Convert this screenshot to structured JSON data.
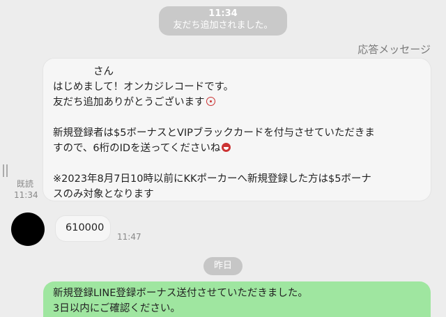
{
  "system_notice": {
    "time": "11:34",
    "text": "友だち追加されました。"
  },
  "auto_reply_label": "応答メッセージ",
  "main_message": {
    "greeting": "さん",
    "lines": [
      "はじめまして！オンカジレコードです。",
      "友だち追加ありがとうございます",
      "新規登録者は$5ボーナスとVIPブラックカードを付与させていただきま",
      "すので、6桁のIDを送ってくださいね",
      "※2023年8月7日10時以前にKKポーカーへ新規登録した方は$5ボーナ",
      "スのみ対象となります"
    ],
    "emojis": [
      "surprise-emoji",
      "laugh-emoji"
    ],
    "read_label": "既読",
    "read_time": "11:34"
  },
  "user_message": {
    "text": "610000",
    "time": "11:47"
  },
  "date_separator": "昨日",
  "green_message": {
    "lines": [
      "新規登録LINE登録ボーナス送付させていただきました。",
      "3日以内にご確認ください。"
    ]
  },
  "colors": {
    "background": "#ededed",
    "bubble_gray": "#f6f6f6",
    "bubble_green": "#9fe6a0",
    "system_pill": "#c9c9c9"
  }
}
